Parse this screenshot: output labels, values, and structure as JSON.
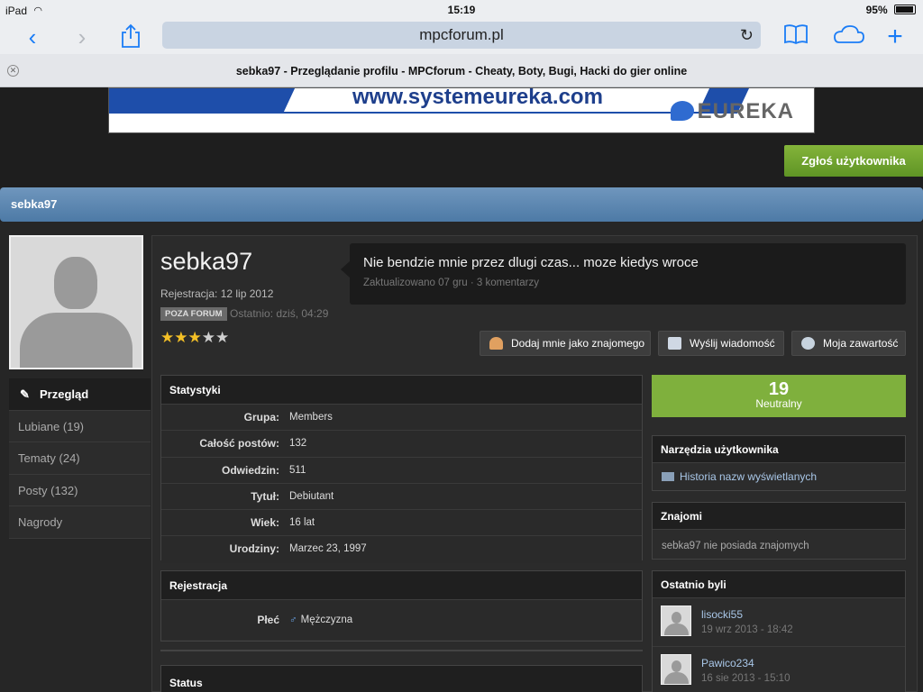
{
  "statusbar": {
    "device": "iPad",
    "time": "15:19",
    "battery": "95%"
  },
  "browser": {
    "url": "mpcforum.pl",
    "tab_title": "sebka97 - Przeglądanie profilu - MPCforum - Cheaty, Boty, Bugi, Hacki do gier online"
  },
  "banner": {
    "url_text": "www.systemeureka.com",
    "logo": "EUREKA"
  },
  "report_button": "Zgłoś użytkownika",
  "profile_bar_title": "sebka97",
  "profile": {
    "username": "sebka97",
    "registered": "Rejestracja: 12 lip 2012",
    "online_badge": "POZA FORUM",
    "last_seen": "Ostatnio: dziś, 04:29",
    "rating_stars": 3,
    "rating_max": 5
  },
  "status": {
    "text": "Nie bendzie mnie przez dlugi czas... moze kiedys wroce",
    "meta": "Zaktualizowano 07 gru · 3 komentarzy"
  },
  "actions": {
    "add_friend": "Dodaj mnie jako znajomego",
    "send_message": "Wyślij wiadomość",
    "my_content": "Moja zawartość"
  },
  "sidenav": [
    {
      "label": "Przegląd"
    },
    {
      "label": "Lubiane (19)"
    },
    {
      "label": "Tematy (24)"
    },
    {
      "label": "Posty (132)"
    },
    {
      "label": "Nagrody"
    }
  ],
  "stats": {
    "title": "Statystyki",
    "rows": [
      {
        "key": "Grupa:",
        "value": "Members"
      },
      {
        "key": "Całość postów:",
        "value": "132"
      },
      {
        "key": "Odwiedzin:",
        "value": "511"
      },
      {
        "key": "Tytuł:",
        "value": "Debiutant"
      },
      {
        "key": "Wiek:",
        "value": "16 lat"
      },
      {
        "key": "Urodziny:",
        "value": "Marzec 23, 1997"
      }
    ]
  },
  "registration": {
    "title": "Rejestracja",
    "gender_key": "Płeć",
    "gender_symbol": "♂",
    "gender_value": "Mężczyzna"
  },
  "status_box_title": "Status",
  "reputation": {
    "value": "19",
    "label": "Neutralny"
  },
  "user_tools": {
    "title": "Narzędzia użytkownika",
    "history_link": "Historia nazw wyświetlanych"
  },
  "friends": {
    "title": "Znajomi",
    "empty_text": "sebka97 nie posiada znajomych"
  },
  "last_visitors": {
    "title": "Ostatnio byli",
    "items": [
      {
        "name": "lisocki55",
        "date": "19 wrz 2013 - 18:42"
      },
      {
        "name": "Pawico234",
        "date": "16 sie 2013 - 15:10"
      }
    ]
  },
  "colors": {
    "accent_green": "#7fb03d",
    "header_blue": "#5a84ae",
    "ios_blue": "#1a7cf6",
    "star_gold": "#f4c026"
  }
}
